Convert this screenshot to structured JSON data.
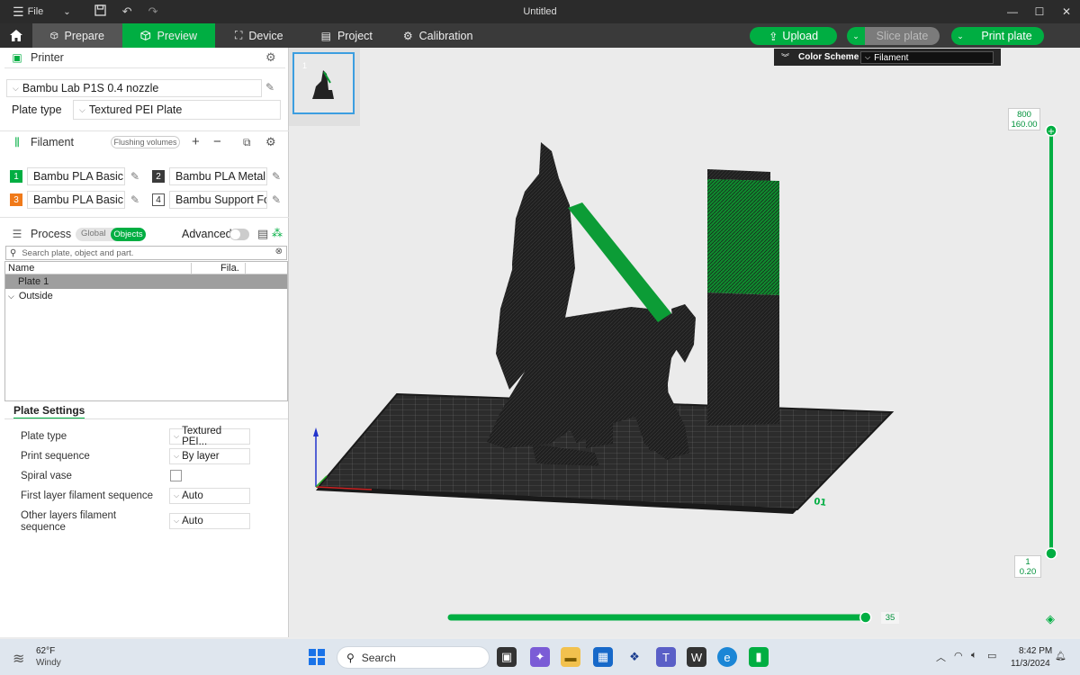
{
  "titlebar": {
    "file_label": "File",
    "title": "Untitled"
  },
  "nav": {
    "tabs": [
      "Prepare",
      "Preview",
      "Device",
      "Project",
      "Calibration"
    ],
    "upload_label": "Upload",
    "slice_label": "Slice plate",
    "print_label": "Print plate"
  },
  "printer": {
    "section_label": "Printer",
    "printer_name": "Bambu Lab P1S 0.4 nozzle",
    "plate_type_label": "Plate type",
    "plate_type_value": "Textured PEI Plate"
  },
  "filament": {
    "section_label": "Filament",
    "flushing_label": "Flushing volumes",
    "items": [
      {
        "num": "1",
        "name": "Bambu PLA Basic",
        "color": "#00ae42"
      },
      {
        "num": "2",
        "name": "Bambu PLA Metal",
        "color": "#3a3a3a"
      },
      {
        "num": "3",
        "name": "Bambu PLA Basic",
        "color": "#f07a1a"
      },
      {
        "num": "4",
        "name": "Bambu Support For...",
        "color": "#ffffff"
      }
    ]
  },
  "process": {
    "section_label": "Process",
    "global_label": "Global",
    "objects_label": "Objects",
    "advanced_label": "Advanced",
    "search_placeholder": "Search plate, object and part.",
    "col_name": "Name",
    "col_fila": "Fila.",
    "rows": [
      "Plate 1",
      "Outside"
    ]
  },
  "plate_settings": {
    "tab_label": "Plate Settings",
    "plate_type_label": "Plate type",
    "plate_type_value": "Textured PEI...",
    "print_sequence_label": "Print sequence",
    "print_sequence_value": "By layer",
    "spiral_vase_label": "Spiral vase",
    "first_layer_label": "First layer filament sequence",
    "first_layer_value": "Auto",
    "other_layers_label_1": "Other layers filament",
    "other_layers_label_2": "sequence",
    "other_layers_value": "Auto"
  },
  "viewport": {
    "plate_thumb_num": "1",
    "color_scheme_label": "Color Scheme",
    "color_scheme_value": "Filament",
    "layer_top_num": "800",
    "layer_top_height": "160.00",
    "layer_bottom_num": "1",
    "layer_bottom_height": "0.20",
    "horizontal_value": "35",
    "horizontal_fraction": 0.97
  },
  "taskbar": {
    "weather_temp": "62°F",
    "weather_desc": "Windy",
    "search_label": "Search",
    "time": "8:42 PM",
    "date": "11/3/2024"
  }
}
